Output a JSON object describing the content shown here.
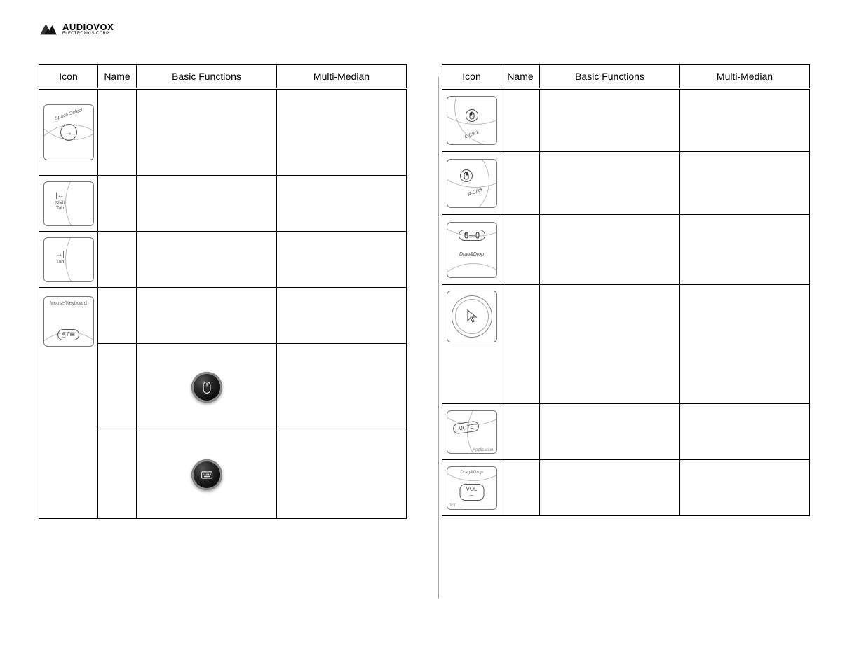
{
  "brand": {
    "name": "AUDIOVOX",
    "sub": "ELECTRONICS CORP."
  },
  "headers": {
    "icon": "Icon",
    "name": "Name",
    "func": "Basic Functions",
    "multi": "Multi-Median"
  },
  "left_rows": [
    {
      "icon_label_top": "Space Select",
      "icon_symbol": "→",
      "height": "h-tall",
      "style": "arrow-right"
    },
    {
      "icon_label_top": "",
      "icon_symbol": "|← Shift Tab",
      "height": "h-med",
      "style": "shift-tab"
    },
    {
      "icon_label_top": "",
      "icon_symbol": "→| Tab",
      "height": "h-med",
      "style": "tab"
    },
    {
      "icon_label_top": "Mouse/Keyboard",
      "icon_symbol": "mouse-kbd",
      "height": "h-med",
      "style": "mouse-kbd"
    },
    {
      "icon_label_top": "",
      "icon_symbol": "led-mouse",
      "height": "h-tall",
      "style": "led",
      "no_tile": true
    },
    {
      "icon_label_top": "",
      "icon_symbol": "led-kbd",
      "height": "h-tall",
      "style": "led",
      "no_tile": true
    }
  ],
  "right_rows": [
    {
      "icon_label_top": "",
      "icon_sub": "L-Click",
      "height": "h-med",
      "style": "lclick"
    },
    {
      "icon_label_top": "",
      "icon_sub": "R-Click",
      "height": "h-med",
      "style": "rclick"
    },
    {
      "icon_label_top": "",
      "icon_sub": "Drag&Drop",
      "height": "h-med",
      "style": "dragdrop"
    },
    {
      "icon_label_top": "",
      "icon_sub": "",
      "height": "h-tall",
      "style": "cursor",
      "extra_tall": true
    },
    {
      "icon_label_top": "",
      "icon_sub": "Application",
      "height": "h-med",
      "style": "mute",
      "btn_text": "MUTE"
    },
    {
      "icon_label_top": "Drag&Drop",
      "icon_sub": "tion",
      "height": "h-med",
      "style": "vol",
      "btn_text": "VOL –"
    }
  ]
}
